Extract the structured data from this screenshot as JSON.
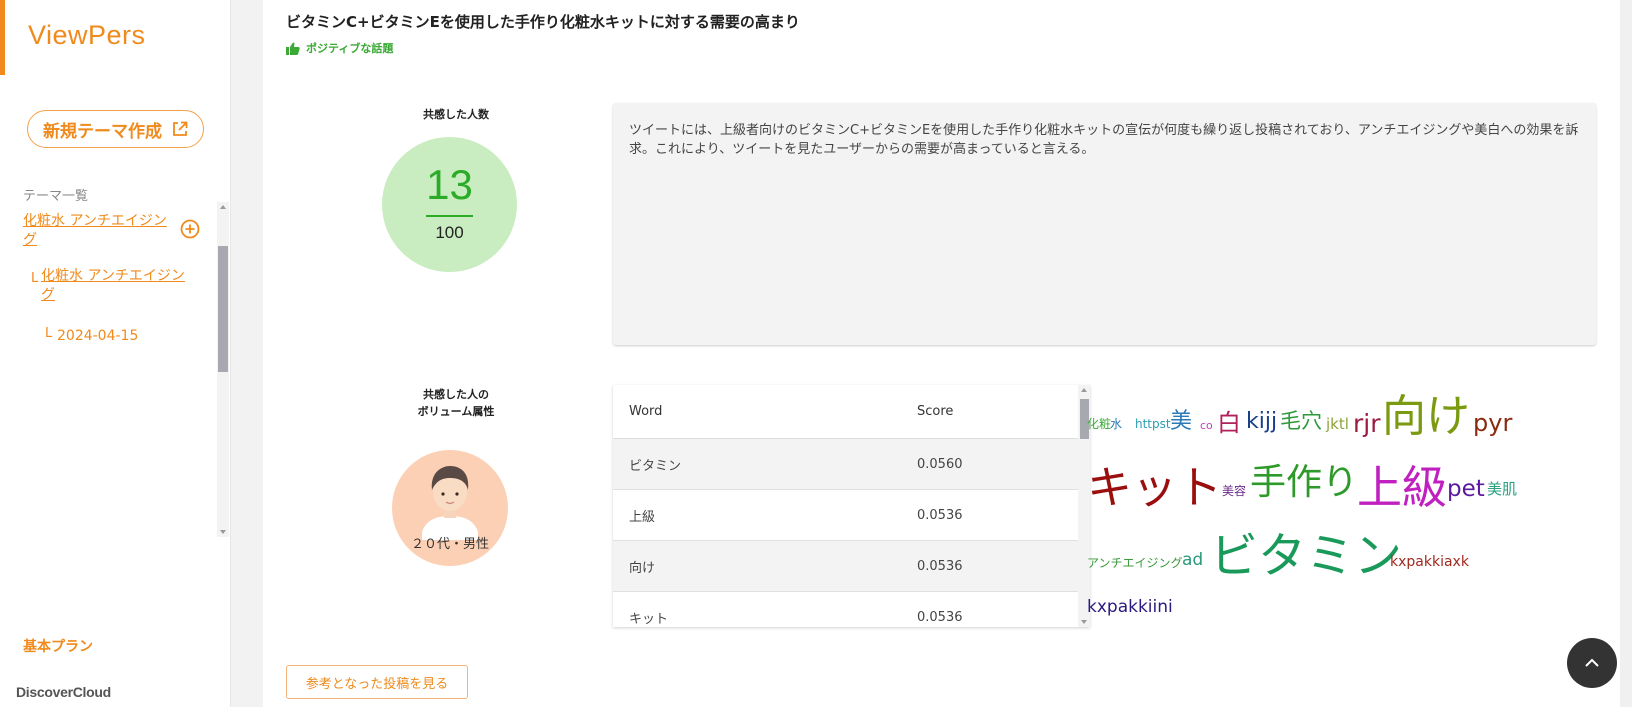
{
  "sidebar": {
    "logo": "ViewPers",
    "new_theme_label": "新規テーマ作成",
    "theme_list_label": "テーマ一覧",
    "tree": {
      "root_line1": "化粧水 アンチエイジン",
      "root_line2": "グ",
      "child_line1": "化粧水 アンチエイジン",
      "child_line2": "グ",
      "prefix": "L",
      "date": "2024-04-15"
    },
    "plan": "基本プラン",
    "footer_logo": "DiscoverCloud"
  },
  "topic": {
    "title": "ビタミンC+ビタミンEを使用した手作り化粧水キットに対する需要の高まり",
    "sentiment": "ポジティブな話題",
    "sentiment_color": "#3aaa35"
  },
  "empathy": {
    "label": "共感した人数",
    "count": "13",
    "total": "100"
  },
  "summary": "ツイートには、上級者向けのビタミンC+ビタミンEを使用した手作り化粧水キットの宣伝が何度も繰り返し投稿されており、アンチエイジングや美白への効果を訴求。これにより、ツイートを見たユーザーからの需要が高まっていると言える。",
  "volume": {
    "label_line1": "共感した人の",
    "label_line2": "ボリューム属性",
    "caption": "２０代・男性"
  },
  "table": {
    "headers": [
      "Word",
      "Score"
    ],
    "rows": [
      {
        "word": "ビタミン",
        "score": "0.0560"
      },
      {
        "word": "上級",
        "score": "0.0536"
      },
      {
        "word": "向け",
        "score": "0.0536"
      },
      {
        "word": "キット",
        "score": "0.0536"
      }
    ]
  },
  "wordcloud": {
    "words": [
      {
        "text": "化粧",
        "color": "#3aaa35"
      },
      {
        "text": "水",
        "color": "#2a7ab8"
      },
      {
        "text": "httpst",
        "color": "#2a9db0"
      },
      {
        "text": "美",
        "color": "#2a7ab8"
      },
      {
        "text": "co",
        "color": "#c040c0"
      },
      {
        "text": "白",
        "color": "#b0205a"
      },
      {
        "text": "kijj",
        "color": "#1a3f8a"
      },
      {
        "text": "毛穴",
        "color": "#2d9a3a"
      },
      {
        "text": "jktl",
        "color": "#8da43a"
      },
      {
        "text": "rjr",
        "color": "#9b1b40"
      },
      {
        "text": "向け",
        "color": "#7a9a10"
      },
      {
        "text": "pyr",
        "color": "#8a2a10"
      },
      {
        "text": "キット",
        "color": "#9a0e0e"
      },
      {
        "text": "美容",
        "color": "#6a2a8a"
      },
      {
        "text": "手作り",
        "color": "#2e9a2a"
      },
      {
        "text": "上級",
        "color": "#c020c0"
      },
      {
        "text": "pet",
        "color": "#5a1aa0"
      },
      {
        "text": "美肌",
        "color": "#2aa080"
      },
      {
        "text": "アンチエイジング",
        "color": "#3a9a3a"
      },
      {
        "text": "ad",
        "color": "#2a9a7a"
      },
      {
        "text": "ビタミン",
        "color": "#1a9a5a"
      },
      {
        "text": "kxpakkiaxk",
        "color": "#a02a20"
      },
      {
        "text": "kxpakkiini",
        "color": "#2a1a80"
      }
    ]
  },
  "reference_button": "参考となった投稿を見る",
  "colors": {
    "accent": "#f08a1c",
    "score_circle": "#c9ecc0",
    "score_text": "#2bab28",
    "avatar_bg": "#fbd0b4"
  }
}
